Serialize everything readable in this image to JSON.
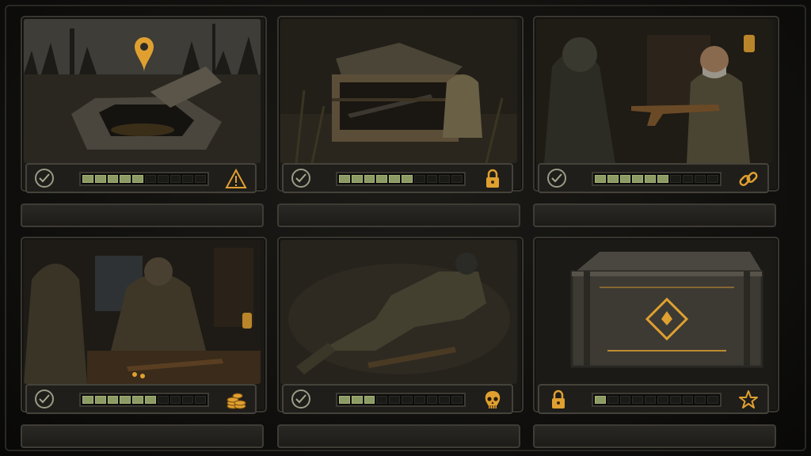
{
  "cards": [
    {
      "name": "hidden-stash-card",
      "scene": "stash-hatch",
      "status_left": "check-icon",
      "progress": 0.5,
      "right_icon": "warning-icon",
      "accent": "#e0a030"
    },
    {
      "name": "supply-crate-card",
      "scene": "supply-crate",
      "status_left": "check-icon",
      "progress": 0.6,
      "right_icon": "lock-icon",
      "accent": "#e0a030"
    },
    {
      "name": "trade-deal-card",
      "scene": "trade",
      "status_left": "check-icon",
      "progress": 0.6,
      "right_icon": "chain-link-icon",
      "accent": "#e0a030"
    },
    {
      "name": "trader-card",
      "scene": "trader",
      "status_left": "check-icon",
      "progress": 0.6,
      "right_icon": "coins-icon",
      "accent": "#e0a030"
    },
    {
      "name": "fallen-soldier-card",
      "scene": "fallen-soldier",
      "status_left": "check-icon",
      "progress": 0.3,
      "right_icon": "skull-icon",
      "accent": "#e0a030"
    },
    {
      "name": "locked-chest-card",
      "scene": "chest",
      "status_left": "lock-icon",
      "progress": 0.1,
      "right_icon": "star-icon",
      "accent": "#e0a030"
    }
  ]
}
